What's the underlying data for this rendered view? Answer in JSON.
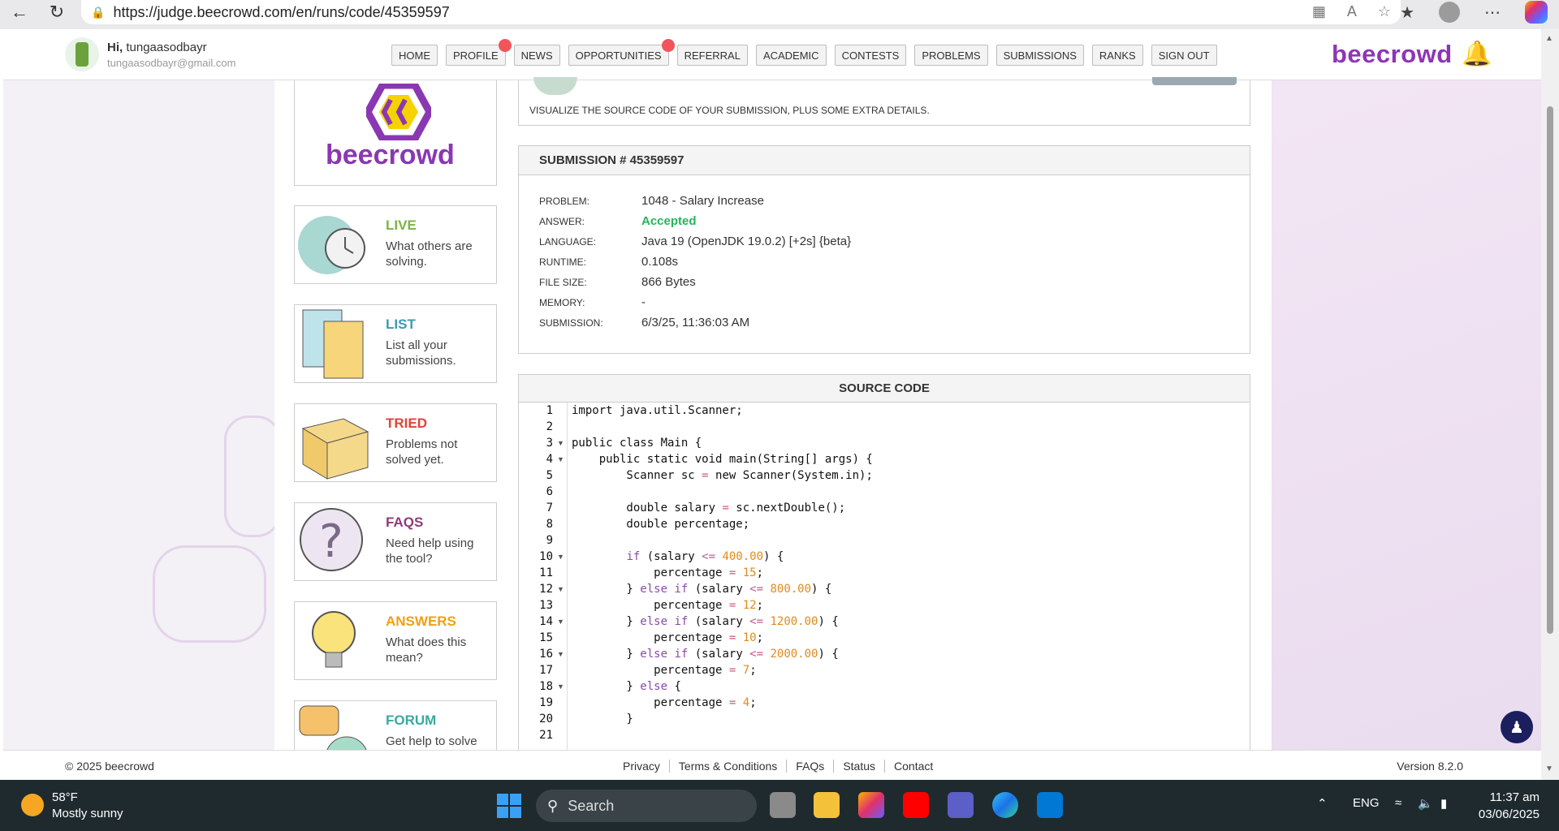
{
  "browser": {
    "url": "https://judge.beecrowd.com/en/runs/code/45359597"
  },
  "header": {
    "greeting_prefix": "Hi,",
    "username": "tungaasodbayr",
    "email": "tungaasodbayr@gmail.com",
    "menu": [
      "HOME",
      "PROFILE",
      "NEWS",
      "OPPORTUNITIES",
      "REFERRAL",
      "ACADEMIC",
      "CONTESTS",
      "PROBLEMS",
      "SUBMISSIONS",
      "RANKS",
      "SIGN OUT"
    ],
    "brand": "beecrowd"
  },
  "sidebar": {
    "logo_text": "beecrowd",
    "cards": [
      {
        "title": "LIVE",
        "desc": "What others are solving.",
        "color": "#7cb342"
      },
      {
        "title": "LIST",
        "desc": "List all your submissions.",
        "color": "#3a9ab8"
      },
      {
        "title": "TRIED",
        "desc": "Problems not solved yet.",
        "color": "#e0433a"
      },
      {
        "title": "FAQS",
        "desc": "Need help using the tool?",
        "color": "#8e3a7d"
      },
      {
        "title": "ANSWERS",
        "desc": "What does this mean?",
        "color": "#f0a012"
      },
      {
        "title": "FORUM",
        "desc": "Get help to solve",
        "color": "#3aa8a0"
      }
    ]
  },
  "top_panel": {
    "description": "VISUALIZE THE SOURCE CODE OF YOUR SUBMISSION, PLUS SOME EXTRA DETAILS."
  },
  "submission": {
    "heading": "SUBMISSION # 45359597",
    "rows": [
      {
        "label": "PROBLEM:",
        "value": "1048 - Salary Increase"
      },
      {
        "label": "ANSWER:",
        "value": "Accepted"
      },
      {
        "label": "LANGUAGE:",
        "value": "Java 19 (OpenJDK 19.0.2) [+2s] {beta}"
      },
      {
        "label": "RUNTIME:",
        "value": "0.108s"
      },
      {
        "label": "FILE SIZE:",
        "value": "866 Bytes"
      },
      {
        "label": "MEMORY:",
        "value": "-"
      },
      {
        "label": "SUBMISSION:",
        "value": "6/3/25, 11:36:03 AM"
      }
    ]
  },
  "source": {
    "heading": "SOURCE CODE",
    "lines": [
      "import java.util.Scanner;",
      "",
      "public class Main {",
      "    public static void main(String[] args) {",
      "        Scanner sc = new Scanner(System.in);",
      "",
      "        double salary = sc.nextDouble();",
      "        double percentage;",
      "",
      "        if (salary <= 400.00) {",
      "            percentage = 15;",
      "        } else if (salary <= 800.00) {",
      "            percentage = 12;",
      "        } else if (salary <= 1200.00) {",
      "            percentage = 10;",
      "        } else if (salary <= 2000.00) {",
      "            percentage = 7;",
      "        } else {",
      "            percentage = 4;",
      "        }",
      ""
    ],
    "fold_lines": [
      3,
      4,
      10,
      12,
      14,
      16,
      18
    ]
  },
  "footer": {
    "copyright": "© 2025 beecrowd",
    "links": [
      "Privacy",
      "Terms & Conditions",
      "FAQs",
      "Status",
      "Contact"
    ],
    "version": "Version 8.2.0"
  },
  "taskbar": {
    "temperature": "58°F",
    "weather": "Mostly sunny",
    "search_placeholder": "Search",
    "language": "ENG",
    "time": "11:37 am",
    "date": "03/06/2025"
  },
  "colors": {
    "brand": "#8e35b6",
    "accepted": "#27b45a"
  }
}
